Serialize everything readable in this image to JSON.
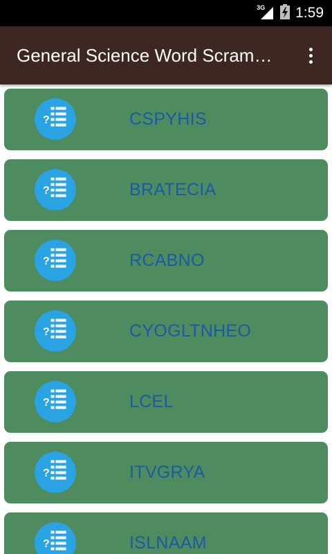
{
  "status_bar": {
    "network_label": "3G",
    "time": "1:59",
    "icons": [
      "signal-icon",
      "battery-charging-icon"
    ]
  },
  "app_bar": {
    "title": "General Science Word Scramble",
    "menu_icon": "more-vert-icon"
  },
  "words": [
    {
      "word": "CSPYHIS",
      "icon": "quiz-list-icon"
    },
    {
      "word": "BRATECIA",
      "icon": "quiz-list-icon"
    },
    {
      "word": "RCABNO",
      "icon": "quiz-list-icon"
    },
    {
      "word": "CYOGLTNHEO",
      "icon": "quiz-list-icon"
    },
    {
      "word": "LCEL",
      "icon": "quiz-list-icon"
    },
    {
      "word": "ITVGRYA",
      "icon": "quiz-list-icon"
    },
    {
      "word": "ISLNAAM",
      "icon": "quiz-list-icon"
    }
  ],
  "colors": {
    "status_bar": "#000000",
    "app_bar": "#3e2723",
    "card": "#4e8b5e",
    "icon_circle": "#29a3e2",
    "word_text": "#1a5aa6"
  }
}
